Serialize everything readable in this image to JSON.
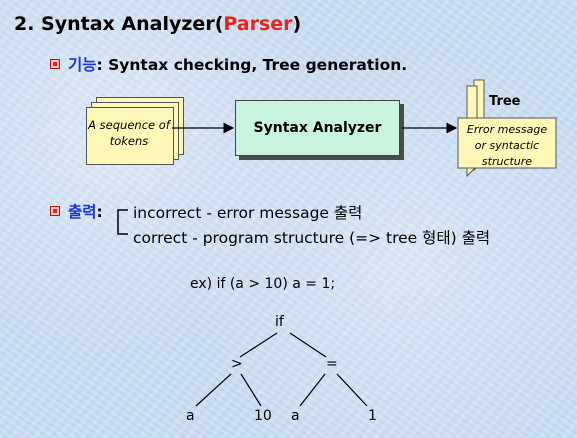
{
  "title": {
    "prefix": "2. Syntax Analyzer(",
    "highlight": "Parser",
    "suffix": ")"
  },
  "function_line": {
    "label": "기능",
    "text": ": Syntax checking, Tree generation."
  },
  "diagram": {
    "input_label": "A sequence of tokens",
    "analyzer_label": "Syntax Analyzer",
    "tree_label": "Tree",
    "output_label": "Error message or syntactic structure"
  },
  "output": {
    "label": "출력",
    "colon": ":",
    "options": [
      "incorrect  -   error message 출력",
      "correct   -   program structure (=> tree 형태) 출력"
    ]
  },
  "example": {
    "text": "ex) if (a > 10) a = 1;",
    "tree_nodes": {
      "root": "if",
      "cond": ">",
      "assign": "=",
      "a1": "a",
      "ten": "10",
      "a2": "a",
      "one": "1"
    }
  },
  "colors": {
    "accent_red": "#e8231b",
    "accent_blue": "#1a37d6",
    "analyzer_fill": "#c9f3dc",
    "card_fill": "#fff7b8"
  }
}
